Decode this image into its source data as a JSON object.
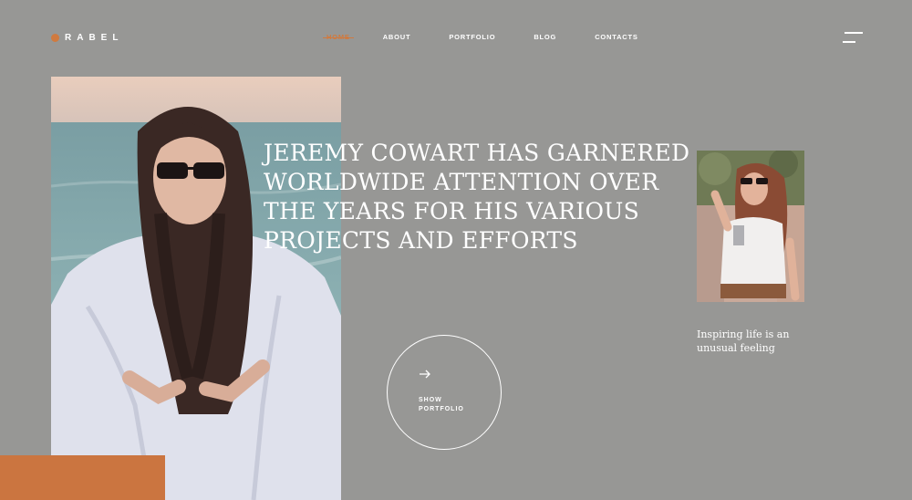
{
  "brand": {
    "name": "RABEL",
    "accent": "#d07a3f"
  },
  "nav": {
    "items": [
      {
        "label": "HOME",
        "active": true
      },
      {
        "label": "ABOUT"
      },
      {
        "label": "PORTFOLIO"
      },
      {
        "label": "BLOG"
      },
      {
        "label": "CONTACTS"
      }
    ]
  },
  "menu_icon": "hamburger-icon",
  "hero": {
    "headline": "Jeremy Cowart has garnered worldwide attention over the years for his various projects and efforts",
    "cta_label": "SHOW PORTFOLIO",
    "cta_icon": "arrow-right-icon"
  },
  "side": {
    "caption": "Inspiring life is an unusual feeling"
  },
  "colors": {
    "background": "#979795",
    "orange_block": "#cb7540"
  }
}
